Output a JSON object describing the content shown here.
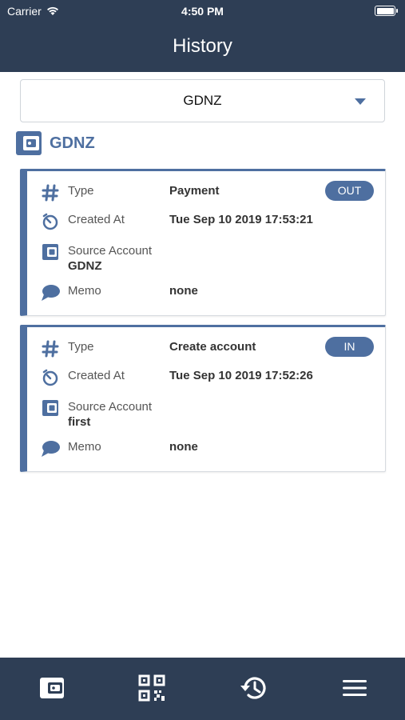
{
  "status_bar": {
    "carrier": "Carrier",
    "time": "4:50 PM"
  },
  "header": {
    "title": "History"
  },
  "account_selector": {
    "selected": "GDNZ"
  },
  "account_header": {
    "name": "GDNZ",
    "icon": "wallet-icon"
  },
  "transactions": [
    {
      "type_label": "Type",
      "type_value": "Payment",
      "direction": "OUT",
      "created_label": "Created At",
      "created_value": "Tue Sep 10 2019 17:53:21",
      "source_label": "Source Account",
      "source_value": "GDNZ",
      "memo_label": "Memo",
      "memo_value": "none"
    },
    {
      "type_label": "Type",
      "type_value": "Create account",
      "direction": "IN",
      "created_label": "Created At",
      "created_value": "Tue Sep 10 2019 17:52:26",
      "source_label": "Source Account",
      "source_value": "first",
      "memo_label": "Memo",
      "memo_value": "none"
    }
  ],
  "tab_bar": {
    "items": [
      {
        "icon": "wallet-icon",
        "active": false
      },
      {
        "icon": "qr-code-icon",
        "active": false
      },
      {
        "icon": "history-icon",
        "active": true
      },
      {
        "icon": "menu-icon",
        "active": false
      }
    ]
  },
  "colors": {
    "header_bg": "#2e3e55",
    "accent": "#4e6fa0"
  }
}
